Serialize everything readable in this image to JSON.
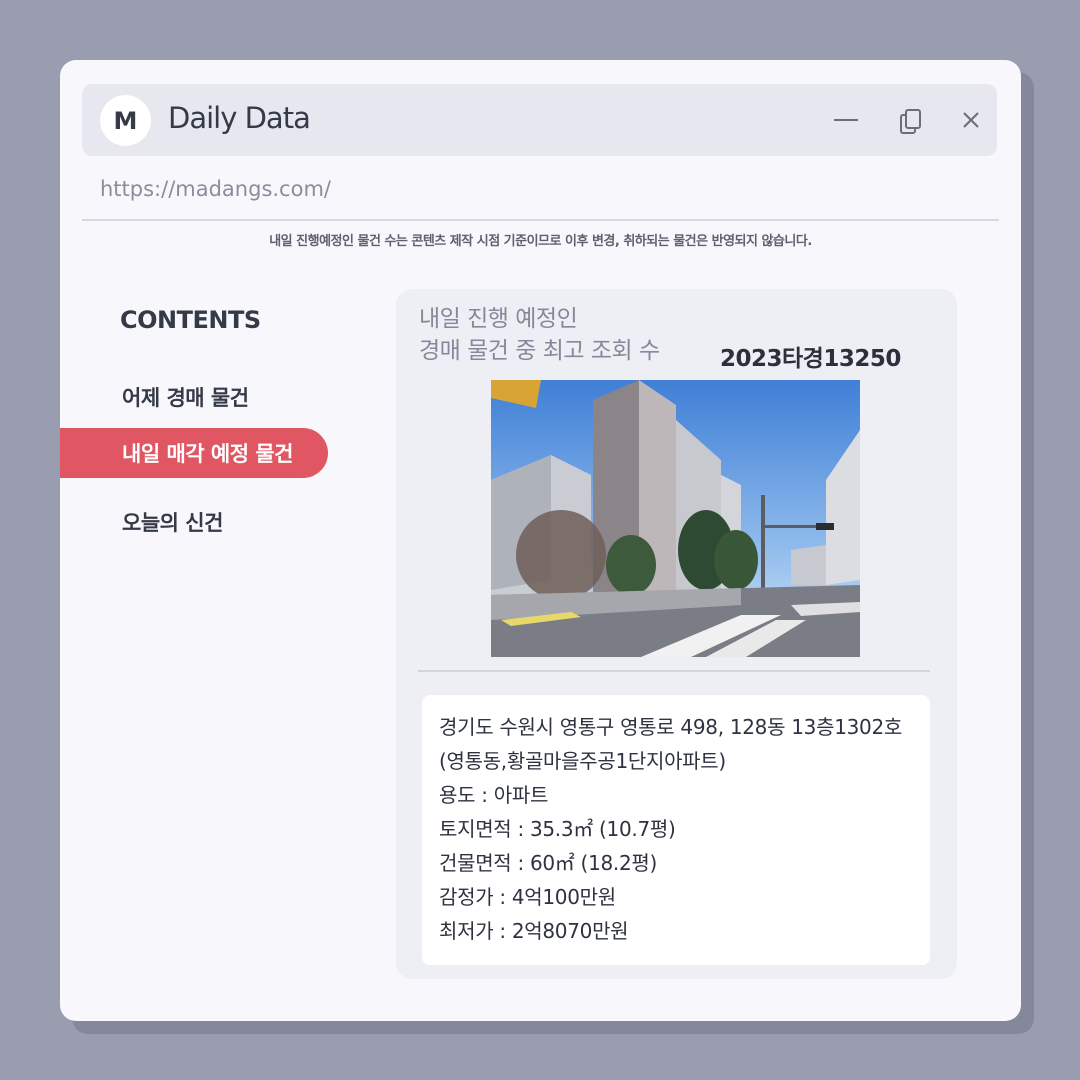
{
  "app": {
    "logo_letter": "M",
    "title": "Daily Data",
    "url": "https://madangs.com/"
  },
  "notice": "내일 진행예정인 물건 수는 콘텐츠 제작 시점 기준이므로 이후 변경, 취하되는 물건은 반영되지 않습니다.",
  "sidebar": {
    "title": "CONTENTS",
    "items": [
      {
        "label": "어제 경매 물건",
        "active": false
      },
      {
        "label": "내일 매각 예정 물건",
        "active": true
      },
      {
        "label": "오늘의 신건",
        "active": false
      }
    ]
  },
  "card": {
    "heading_line1": "내일 진행 예정인",
    "heading_line2": "경매 물건 중 최고 조회 수",
    "case_number": "2023타경13250",
    "details": [
      "경기도 수원시 영통구 영통로 498, 128동 13층1302호",
      "(영통동,황골마을주공1단지아파트)",
      "용도 : 아파트",
      "토지면적 : 35.3㎡ (10.7평)",
      "건물면적 : 60㎡ (18.2평)",
      "감정가 : 4억100만원",
      "최저가 : 2억8070만원"
    ]
  },
  "colors": {
    "background": "#9a9caf",
    "window": "#f8f8fc",
    "accent": "#e05763",
    "titlebar": "#e6e7ef"
  },
  "icons": [
    "minimize-icon",
    "copy-icon",
    "close-icon"
  ]
}
